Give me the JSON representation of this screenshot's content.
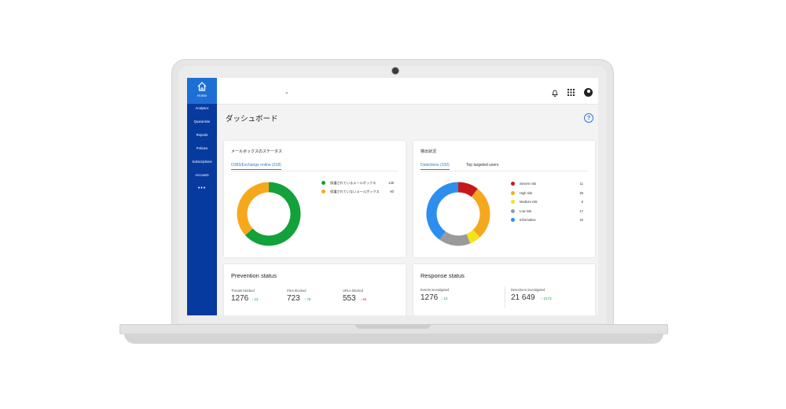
{
  "sidebar": {
    "home_label": "Home",
    "items": [
      "Analytics",
      "Quarantine",
      "Reports",
      "Policies",
      "Subscriptions",
      "Accounts"
    ],
    "more": "•••"
  },
  "header": {
    "page_title": "ダッシュボード",
    "help": "?"
  },
  "mailbox_card": {
    "title": "メールボックスのステータス",
    "tab": "O365/Exchange online (218)",
    "legend": [
      {
        "label": "保護されているメールボックス",
        "value": "138",
        "color": "#12a13a"
      },
      {
        "label": "保護されていないメールボックス",
        "value": "80",
        "color": "#f6a81d"
      }
    ],
    "chart_data": {
      "type": "pie",
      "categories": [
        "保護されているメールボックス",
        "保護されていないメールボックス"
      ],
      "values": [
        138,
        80
      ]
    }
  },
  "detection_card": {
    "title": "検出状況",
    "tabs": [
      "Detections (102)",
      "Top targeted users"
    ],
    "legend": [
      {
        "label": "Severe risk",
        "value": "11",
        "color": "#c5191d"
      },
      {
        "label": "High risk",
        "value": "29",
        "color": "#f6a81d"
      },
      {
        "label": "Medium risk",
        "value": "6",
        "color": "#f5e218"
      },
      {
        "label": "Low risk",
        "value": "17",
        "color": "#9a9a9a"
      },
      {
        "label": "Informative",
        "value": "42",
        "color": "#2d8ef0"
      }
    ],
    "chart_data": {
      "type": "pie",
      "categories": [
        "Severe risk",
        "High risk",
        "Medium risk",
        "Low risk",
        "Informative"
      ],
      "values": [
        11,
        29,
        6,
        17,
        42
      ]
    }
  },
  "prevention_card": {
    "title": "Prevention status",
    "stats": [
      {
        "label": "Threats blocked",
        "value": "1276",
        "delta": "↑ 12",
        "trend": "up"
      },
      {
        "label": "Files blocked",
        "value": "723",
        "delta": "↑ 76",
        "trend": "up"
      },
      {
        "label": "URLs blocked",
        "value": "553",
        "delta": "↓ 64",
        "trend": "down"
      }
    ]
  },
  "response_card": {
    "title": "Response status",
    "stats": [
      {
        "label": "Events investigated",
        "value": "1276",
        "delta": "↑ 12",
        "trend": "up"
      },
      {
        "label": "Detections investigated",
        "value": "21 649",
        "delta": "↑ 2173",
        "trend": "up"
      }
    ]
  }
}
